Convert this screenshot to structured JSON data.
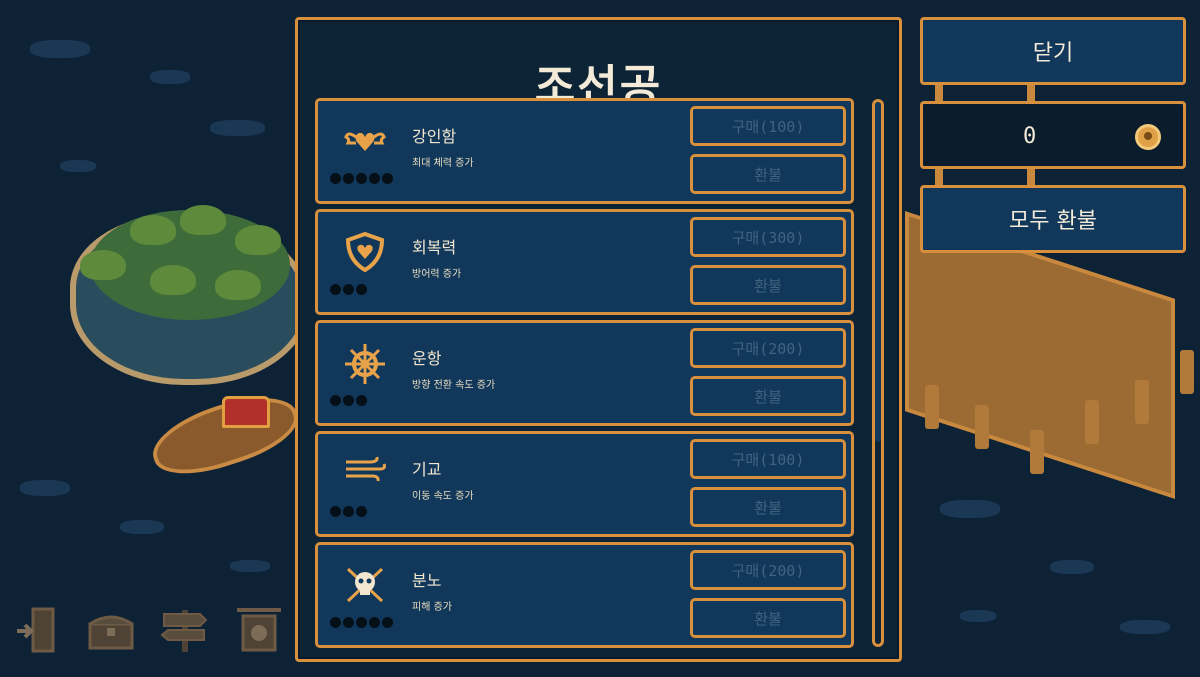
{
  "panel": {
    "title": "조선공"
  },
  "upgrades": [
    {
      "name": "강인함",
      "description": "최대 체력 증가",
      "icon": "wings-heart-icon",
      "level_pips": 5,
      "buy_label": "구매(100)",
      "refund_label": "환불"
    },
    {
      "name": "회복력",
      "description": "방어력 증가",
      "icon": "shield-heart-icon",
      "level_pips": 3,
      "buy_label": "구매(300)",
      "refund_label": "환불"
    },
    {
      "name": "운항",
      "description": "방향 전환 속도 증가",
      "icon": "ship-wheel-icon",
      "level_pips": 3,
      "buy_label": "구매(200)",
      "refund_label": "환불"
    },
    {
      "name": "기교",
      "description": "이동 속도 증가",
      "icon": "wind-icon",
      "level_pips": 3,
      "buy_label": "구매(100)",
      "refund_label": "환불"
    },
    {
      "name": "분노",
      "description": "피해 증가",
      "icon": "skull-crossed-swords-icon",
      "level_pips": 5,
      "buy_label": "구매(200)",
      "refund_label": "환불"
    }
  ],
  "side": {
    "close_label": "닫기",
    "coin_count": "0",
    "coin_icon": "skull-coin-icon",
    "refund_all_label": "모두 환불"
  },
  "bottom_nav": [
    {
      "icon": "exit-door-icon"
    },
    {
      "icon": "treasure-chest-icon"
    },
    {
      "icon": "signpost-icon"
    },
    {
      "icon": "shop-sign-icon"
    }
  ],
  "colors": {
    "accent": "#d9903c",
    "panel_bg": "#0d2436",
    "item_bg": "#11385a",
    "disabled_text": "#3f6380",
    "text": "#f2e6d0"
  }
}
